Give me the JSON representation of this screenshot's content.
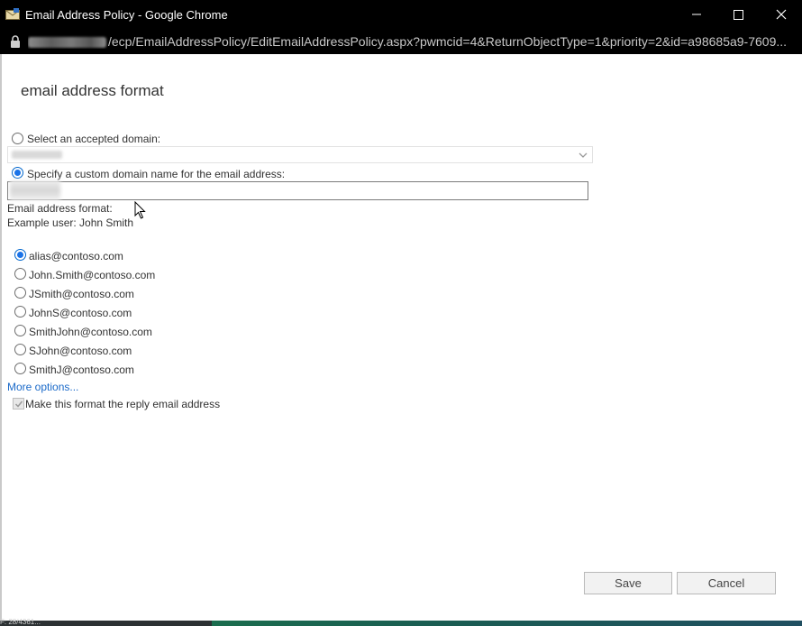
{
  "window": {
    "title": "Email Address Policy - Google Chrome",
    "url_path": "/ecp/EmailAddressPolicy/EditEmailAddressPolicy.aspx?pwmcid=4&ReturnObjectType=1&priority=2&id=a98685a9-7609..."
  },
  "page": {
    "heading": "email address format",
    "domain_options": {
      "accepted_label": "Select an accepted domain:",
      "custom_label": "Specify a custom domain name for the email address:",
      "selected": "custom"
    },
    "format_label": "Email address format:",
    "example_user": "Example user: John Smith",
    "formats": [
      {
        "label": "alias@contoso.com",
        "checked": true
      },
      {
        "label": "John.Smith@contoso.com",
        "checked": false
      },
      {
        "label": "JSmith@contoso.com",
        "checked": false
      },
      {
        "label": "JohnS@contoso.com",
        "checked": false
      },
      {
        "label": "SmithJohn@contoso.com",
        "checked": false
      },
      {
        "label": "SJohn@contoso.com",
        "checked": false
      },
      {
        "label": "SmithJ@contoso.com",
        "checked": false
      }
    ],
    "more_options": "More options...",
    "reply_checkbox_label": "Make this format the reply email address",
    "reply_checked": true
  },
  "buttons": {
    "save": "Save",
    "cancel": "Cancel"
  },
  "taskbar": {
    "text": "F: 28/4361..."
  },
  "colors": {
    "titlebar": "#000000",
    "radio_selected": "#1a73e8",
    "link": "#1b6ac9"
  }
}
